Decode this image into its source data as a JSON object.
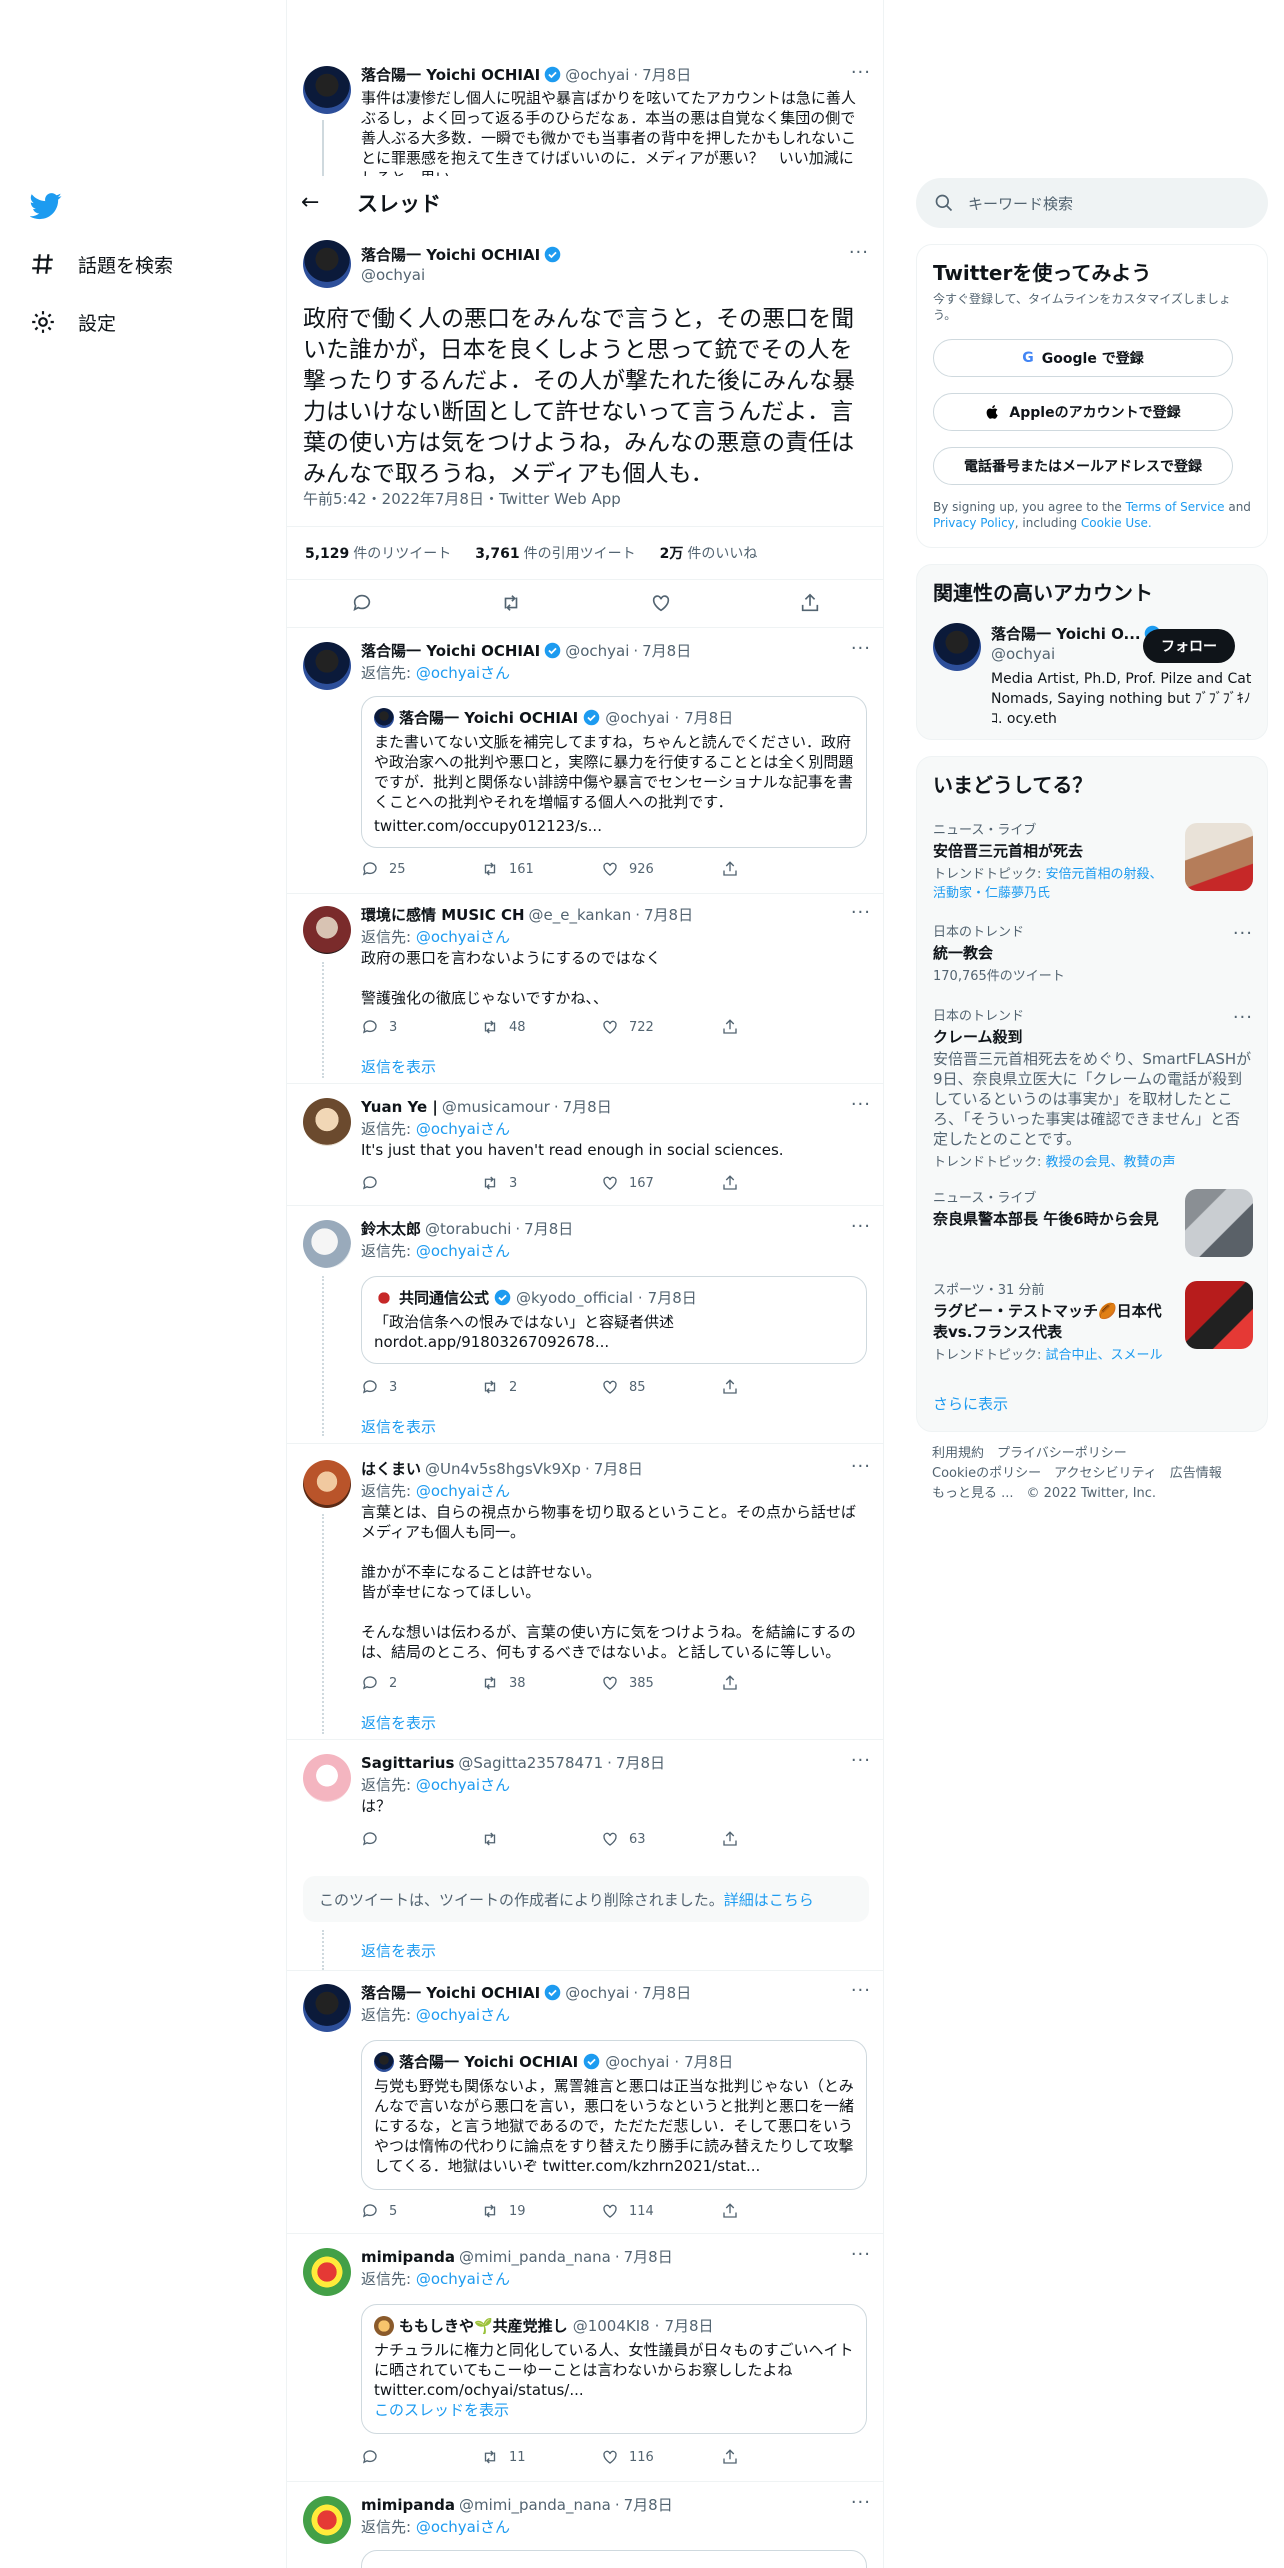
{
  "nav": {
    "explore_label": "話題を検索",
    "settings_label": "設定"
  },
  "thread_header": {
    "title": "スレッド"
  },
  "above_tweet": {
    "name": "落合陽一 Yoichi OCHIAI",
    "handle": "@ochyai",
    "time": "7月8日",
    "text": "事件は凄惨だし個人に呪詛や暴言ばかりを呟いてたアカウントは急に善人ぶるし，よく回って返る手のひらだなぁ．本当の悪は自覚なく集団の側で善人ぶる大多数．一瞬でも微かでも当事者の背中を押したかもしれないことに罪悪感を抱えて生きてけばいいのに．メディアが悪い？　いい加減にしろと，思い"
  },
  "main_tweet": {
    "name": "落合陽一 Yoichi OCHIAI",
    "handle": "@ochyai",
    "text": "政府で働く人の悪口をみんなで言うと，その悪口を聞いた誰かが，日本を良くしようと思って銃でその人を撃ったりするんだよ．その人が撃たれた後にみんな暴力はいけない断固として許せないって言うんだよ．言葉の使い方は気をつけようね，みんなの悪意の責任はみんなで取ろうね，メディアも個人も．",
    "meta": "午前5:42・2022年7月8日・Twitter Web App",
    "retweets_num": "5,129",
    "retweets_label": "件のリツイート",
    "quotes_num": "3,761",
    "quotes_label": "件の引用ツイート",
    "likes_num": "2万",
    "likes_label": "件のいいね"
  },
  "replies": [
    {
      "name": "落合陽一 Yoichi OCHIAI",
      "handle": "@ochyai",
      "time": "7月8日",
      "reply_prefix": "返信先: ",
      "reply_to": "@ochyaiさん",
      "quote_name": "落合陽一 Yoichi OCHIAI",
      "quote_handle": "@ochyai",
      "quote_time": "7月8日",
      "quote_text": "また書いてない文脈を補完してますね，ちゃんと読んでください．政府や政治家への批判や悪口と，実際に暴力を行使することとは全く別問題ですが．批判と関係ない誹謗中傷や暴言でセンセーショナルな記事を書くことへの批判やそれを増幅する個人への批判です．",
      "quote_link": "twitter.com/occupy012123/s...",
      "replies": "25",
      "retweets": "161",
      "likes": "926"
    },
    {
      "name": "環境に感情 MUSIC CH",
      "handle": "@e_e_kankan",
      "time": "7月8日",
      "reply_prefix": "返信先: ",
      "reply_to": "@ochyaiさん",
      "text": "政府の悪口を言わないようにするのではなく\n\n警護強化の徹底じゃないですかね、、",
      "replies": "3",
      "retweets": "48",
      "likes": "722",
      "show_replies": "返信を表示"
    },
    {
      "name": "Yuan Ye |",
      "handle": "@musicamour",
      "time": "7月8日",
      "reply_prefix": "返信先: ",
      "reply_to": "@ochyaiさん",
      "text": "It's just that you haven't read enough in social sciences.",
      "replies": "",
      "retweets": "3",
      "likes": "167"
    },
    {
      "name": "鈴木太郎",
      "handle": "@torabuchi",
      "time": "7月8日",
      "reply_prefix": "返信先: ",
      "reply_to": "@ochyaiさん",
      "quote_name": "共同通信公式",
      "quote_handle": "@kyodo_official",
      "quote_time": "7月8日",
      "quote_text": "「政治信条への恨みではない」と容疑者供述",
      "quote_link": "nordot.app/91803267092678...",
      "replies": "3",
      "retweets": "2",
      "likes": "85",
      "show_replies": "返信を表示"
    },
    {
      "name": "はくまい",
      "handle": "@Un4v5s8hgsVk9Xp",
      "time": "7月8日",
      "reply_prefix": "返信先: ",
      "reply_to": "@ochyaiさん",
      "text": "言葉とは、自らの視点から物事を切り取るということ。その点から話せばメディアも個人も同一。\n\n誰かが不幸になることは許せない。\n皆が幸せになってほしい。\n\nそんな想いは伝わるが、言葉の使い方に気をつけようね。を結論にするのは、結局のところ、何もするべきではないよ。と話しているに等しい。",
      "replies": "2",
      "retweets": "38",
      "likes": "385",
      "show_replies": "返信を表示"
    },
    {
      "name": "Sagittarius",
      "handle": "@Sagitta23578471",
      "time": "7月8日",
      "reply_prefix": "返信先: ",
      "reply_to": "@ochyaiさん",
      "text": "は？",
      "replies": "",
      "retweets": "",
      "likes": "63"
    },
    {
      "name": "落合陽一 Yoichi OCHIAI",
      "handle": "@ochyai",
      "time": "7月8日",
      "reply_prefix": "返信先: ",
      "reply_to": "@ochyaiさん",
      "quote_name": "落合陽一 Yoichi OCHIAI",
      "quote_handle": "@ochyai",
      "quote_time": "7月8日",
      "quote_text": "与党も野党も関係ないよ，罵詈雑言と悪口は正当な批判じゃない（とみんなで言いながら悪口を言い，悪口をいうなというと批判と悪口を一緒にするな，と言う地獄であるので，ただただ悲しい．そして悪口をいうやつは惰怖の代わりに論点をすり替えたり勝手に読み替えたりして攻撃してくる．地獄はいいぞ twitter.com/kzhrn2021/stat...",
      "quote_link": "",
      "replies": "5",
      "retweets": "19",
      "likes": "114"
    },
    {
      "name": "mimipanda",
      "handle": "@mimi_panda_nana",
      "time": "7月8日",
      "reply_prefix": "返信先: ",
      "reply_to": "@ochyaiさん",
      "quote_name": "ももしきや🌱共産党推し",
      "quote_handle": "@1004KI8",
      "quote_time": "7月8日",
      "quote_text": "ナチュラルに権力と同化している人、女性議員が日々ものすごいヘイトに晒されていてもこーゆーことは言わないからお察ししたよね twitter.com/ochyai/status/...",
      "quote_link": "このスレッドを表示",
      "replies": "",
      "retweets": "11",
      "likes": "116"
    },
    {
      "name": "mimipanda",
      "handle": "@mimi_panda_nana",
      "time": "7月8日",
      "reply_prefix": "返信先: ",
      "reply_to": "@ochyaiさん"
    }
  ],
  "deleted": {
    "text": "このツイートは、ツイートの作成者により削除されました。",
    "link": "詳細はこちら",
    "show_replies": "返信を表示"
  },
  "sidebar": {
    "search_placeholder": "キーワード検索",
    "signup": {
      "title": "Twitterを使ってみよう",
      "subtitle": "今すぐ登録して、タイムラインをカスタマイズしましょう。",
      "google": "Google で登録",
      "apple": "Appleのアカウントで登録",
      "phone": "電話番号またはメールアドレスで登録",
      "legal_1": "By signing up, you agree to the ",
      "legal_tos": "Terms of Service",
      "legal_2": " and ",
      "legal_privacy": "Privacy Policy",
      "legal_3": ", including ",
      "legal_cookie": "Cookie Use."
    },
    "relevant": {
      "title": "関連性の高いアカウント",
      "name": "落合陽一 Yoichi O...",
      "handle": "@ochyai",
      "follow": "フォロー",
      "bio": "Media Artist, Ph.D, Prof. Pilze and Cat Nomads, Saying nothing but ﾌﾞﾌﾞﾌﾞｷﾉｺ. ocy.eth"
    },
    "trends": {
      "title": "いまどうしてる？",
      "items": [
        {
          "category": "ニュース・ライブ",
          "title": "安倍晋三元首相が死去",
          "topic_prefix": "トレンドトピック: ",
          "topic": "安倍元首相の射殺、活動家・仁藤夢乃氏"
        },
        {
          "category": "日本のトレンド",
          "title": "統一教会",
          "count": "170,765件のツイート"
        },
        {
          "category": "日本のトレンド",
          "title": "クレーム殺到",
          "desc": "安倍晋三元首相死去をめぐり、SmartFLASHが9日、奈良県立医大に「クレームの電話が殺到しているというのは事実か」を取材したところ、「そういった事実は確認できません」と否定したとのことです。",
          "topic_prefix": "トレンドトピック: ",
          "topic": "教授の会見、教賛の声"
        },
        {
          "category": "ニュース・ライブ",
          "title": "奈良県警本部長 午後6時から会見"
        },
        {
          "category": "スポーツ・31 分前",
          "title": "ラグビー・テストマッチ🏉日本代表vs.フランス代表",
          "topic_prefix": "トレンドトピック: ",
          "topic": "試合中止、スメール"
        }
      ],
      "show_more": "さらに表示"
    },
    "footer": {
      "line1": "利用規約　プライバシーポリシー",
      "line2": "Cookieのポリシー　アクセシビリティ　広告情報",
      "line3": "もっと見る ...　© 2022 Twitter, Inc."
    }
  },
  "colors": {
    "accent": "#1d9bf0",
    "text": "#0f1419",
    "muted": "#536471",
    "border": "#eff3f4"
  }
}
